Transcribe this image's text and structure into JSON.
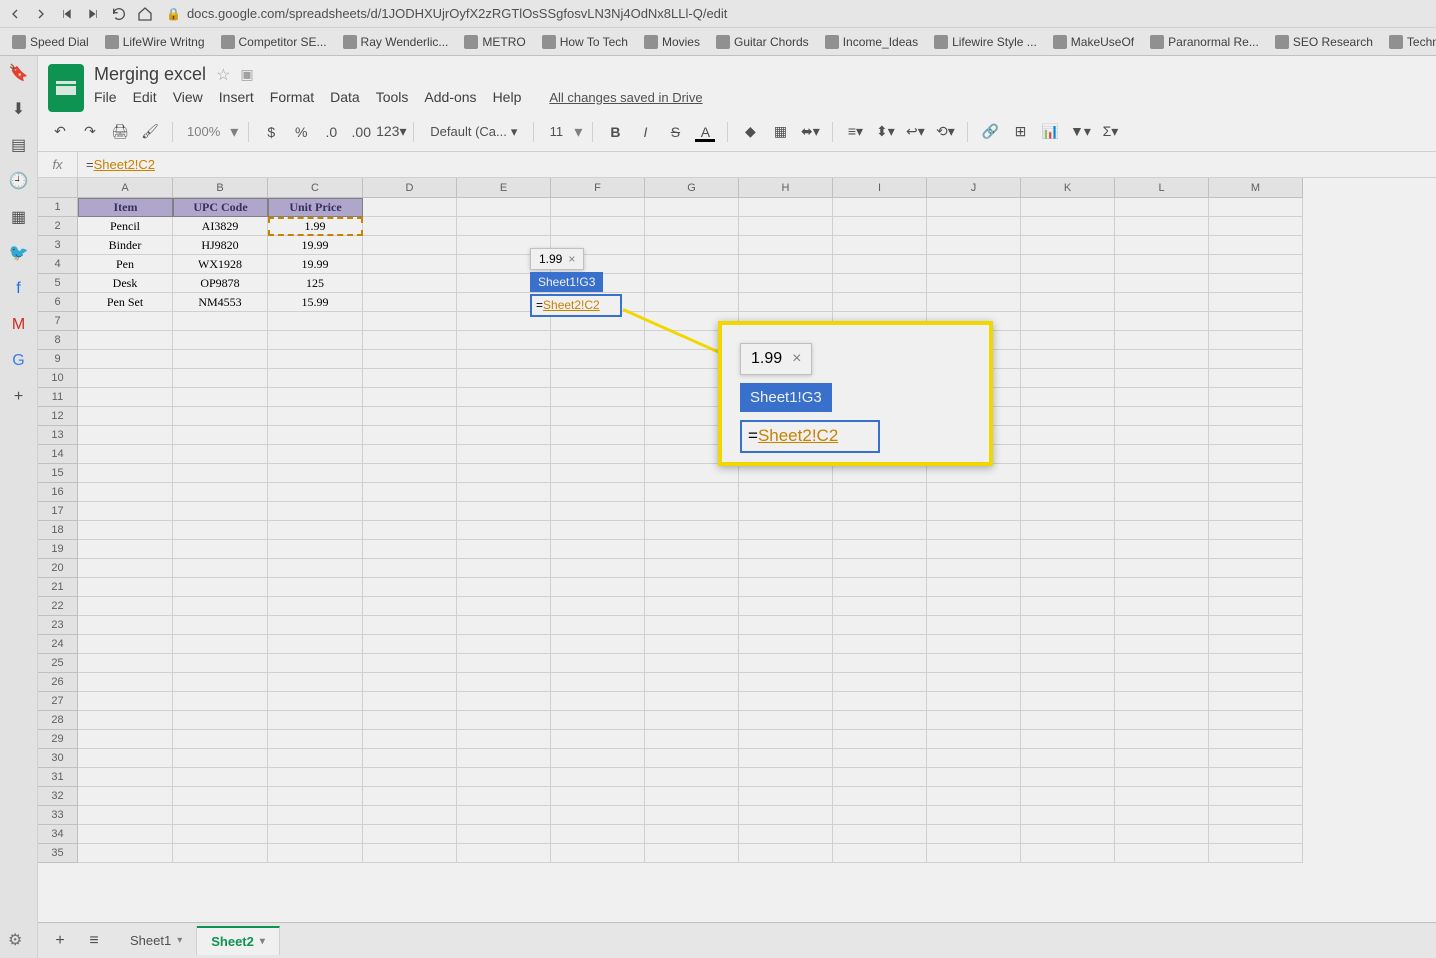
{
  "browser": {
    "url": "docs.google.com/spreadsheets/d/1JODHXUjrOyfX2zRGTlOsSSgfosvLN3Nj4OdNx8LLl-Q/edit"
  },
  "bookmarks": [
    "Speed Dial",
    "LifeWire Writng",
    "Competitor SE...",
    "Ray Wenderlic...",
    "METRO",
    "How To Tech",
    "Movies",
    "Guitar Chords",
    "Income_Ideas",
    "Lifewire Style ...",
    "MakeUseOf",
    "Paranormal Re...",
    "SEO Research",
    "Technology"
  ],
  "doc": {
    "title": "Merging excel",
    "saved": "All changes saved in Drive"
  },
  "menus": [
    "File",
    "Edit",
    "View",
    "Insert",
    "Format",
    "Data",
    "Tools",
    "Add-ons",
    "Help"
  ],
  "toolbar": {
    "zoom": "100%",
    "font": "Default (Ca...",
    "fontSize": "11"
  },
  "formula": {
    "eq": "=",
    "ref": "Sheet2!C2"
  },
  "columns": [
    "A",
    "B",
    "C",
    "D",
    "E",
    "F",
    "G",
    "H",
    "I",
    "J",
    "K",
    "L",
    "M"
  ],
  "rows": 35,
  "headers": [
    "Item",
    "UPC Code",
    "Unit Price"
  ],
  "data": [
    [
      "Pencil",
      "AI3829",
      "1.99"
    ],
    [
      "Binder",
      "HJ9820",
      "19.99"
    ],
    [
      "Pen",
      "WX1928",
      "19.99"
    ],
    [
      "Desk",
      "OP9878",
      "125"
    ],
    [
      "Pen Set",
      "NM4553",
      "15.99"
    ]
  ],
  "tooltip": {
    "value": "1.99",
    "cellRef": "Sheet1!G3",
    "formulaEq": "=",
    "formulaRef": "Sheet2!C2"
  },
  "callout": {
    "value": "1.99",
    "cellRef": "Sheet1!G3",
    "formulaEq": "=",
    "formulaRef": "Sheet2!C2"
  },
  "sheets": {
    "tabs": [
      "Sheet1",
      "Sheet2"
    ],
    "active": "Sheet2"
  }
}
